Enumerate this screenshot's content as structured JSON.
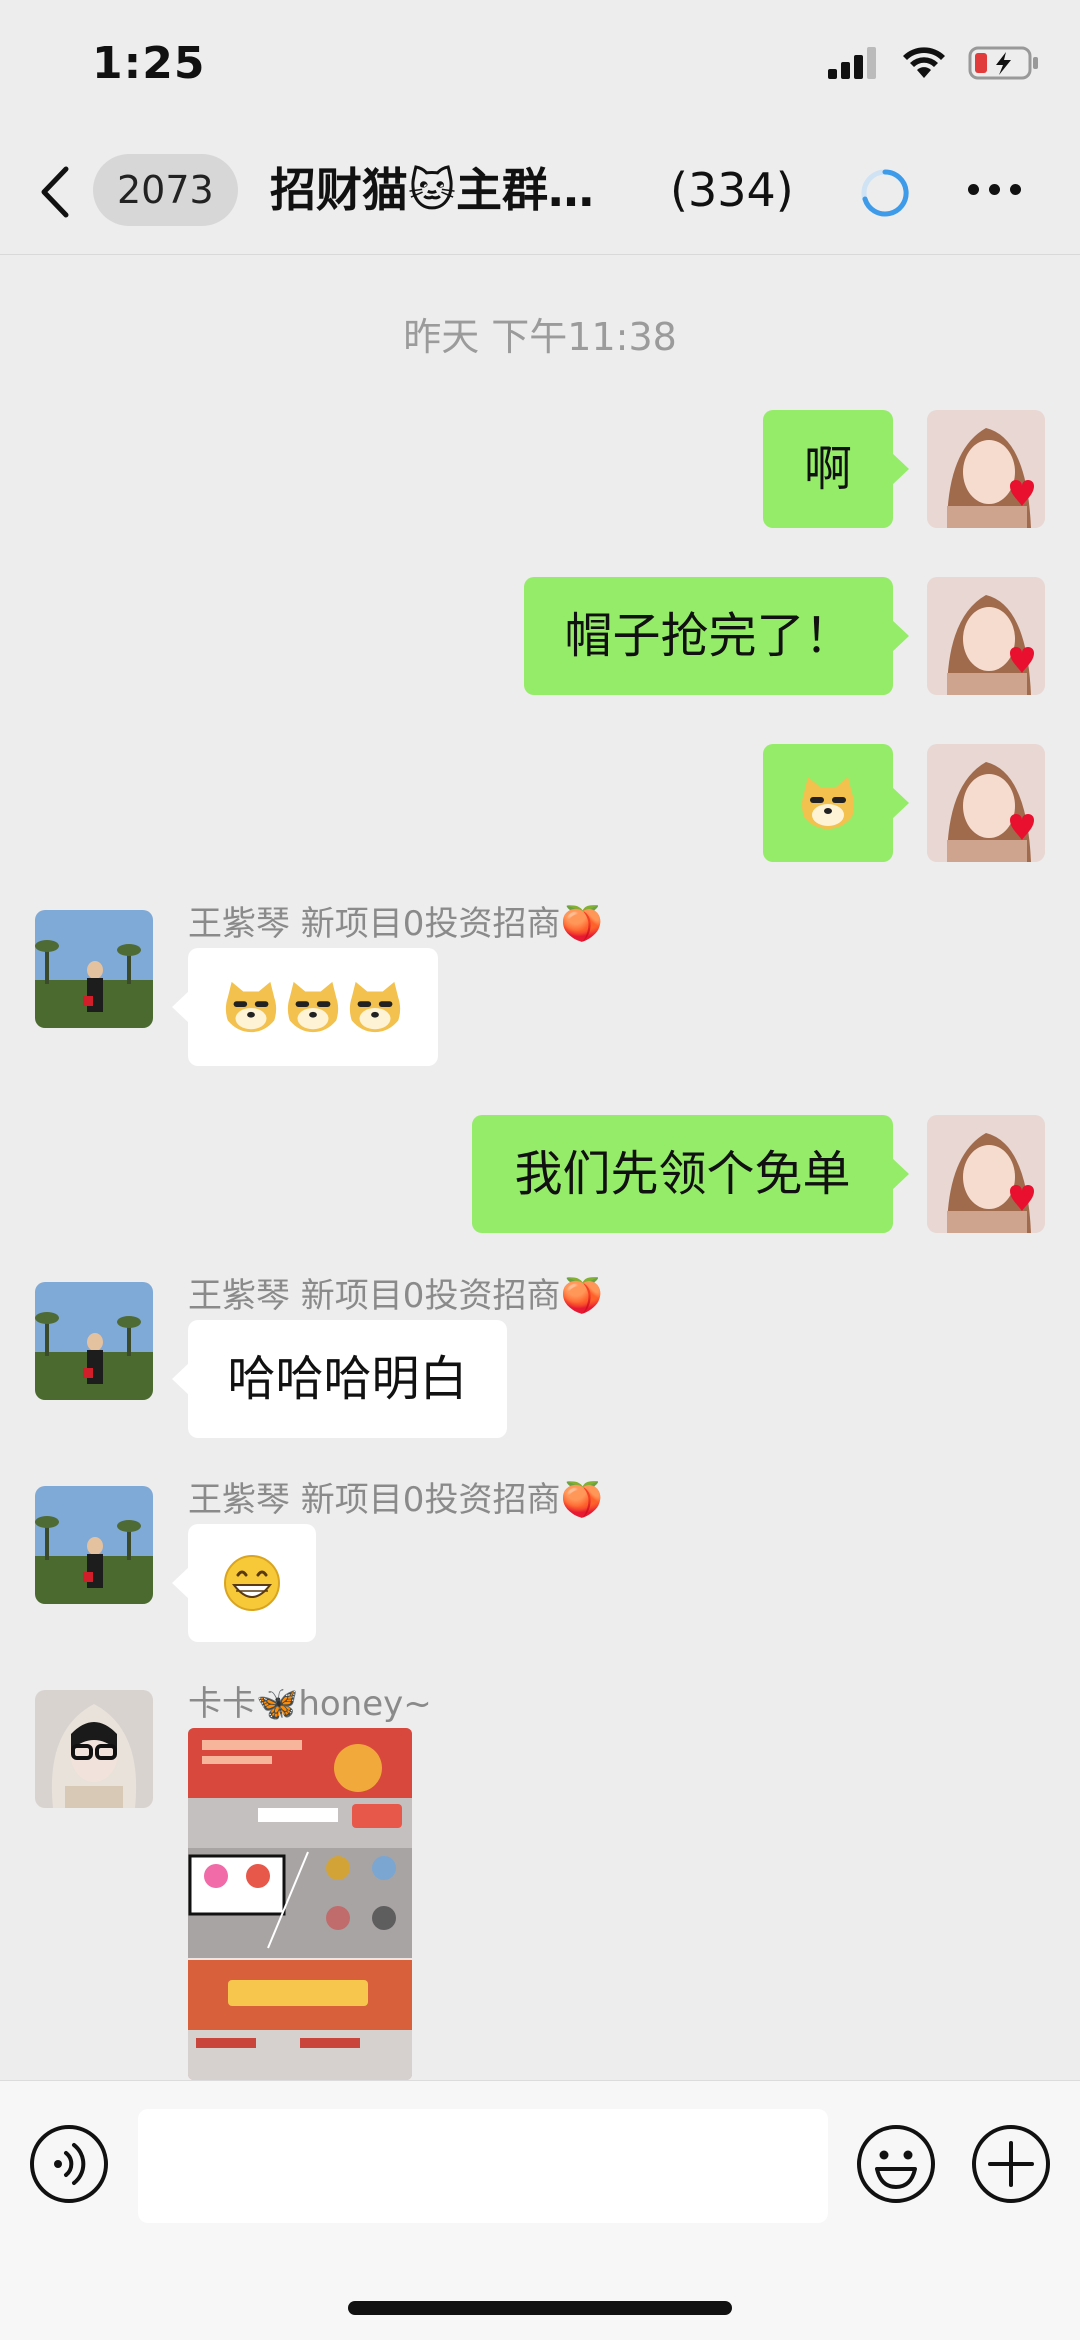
{
  "status_bar": {
    "time": "1:25"
  },
  "header": {
    "unread_count": "2073",
    "title": "招财猫🐱主群…",
    "member_count": "(334)"
  },
  "timestamp": "昨天 下午11:38",
  "messages": [
    {
      "direction": "out",
      "text": "啊"
    },
    {
      "direction": "out",
      "text": "帽子抢完了！"
    },
    {
      "direction": "out",
      "emoji": "doge"
    },
    {
      "direction": "in",
      "sender": "王紫琴 新项目0投资招商🍑",
      "emoji": "doge x3"
    },
    {
      "direction": "out",
      "text": "我们先领个免单"
    },
    {
      "direction": "in",
      "sender": "王紫琴 新项目0投资招商🍑",
      "text": "哈哈哈明白"
    },
    {
      "direction": "in",
      "sender": "王紫琴 新项目0投资招商🍑",
      "emoji": "grin"
    },
    {
      "direction": "in",
      "sender": "卡卡🦋honey~",
      "image": "screenshot"
    }
  ],
  "colors": {
    "background": "#ededed",
    "out_bubble": "#95ec69",
    "in_bubble": "#ffffff",
    "accent_blue": "#3d9be9"
  },
  "icons": {
    "back": "chevron-left-icon",
    "loading": "loading-spinner-icon",
    "more": "more-dots-icon",
    "voice": "voice-icon",
    "emoji": "emoji-icon",
    "plus": "plus-icon"
  }
}
